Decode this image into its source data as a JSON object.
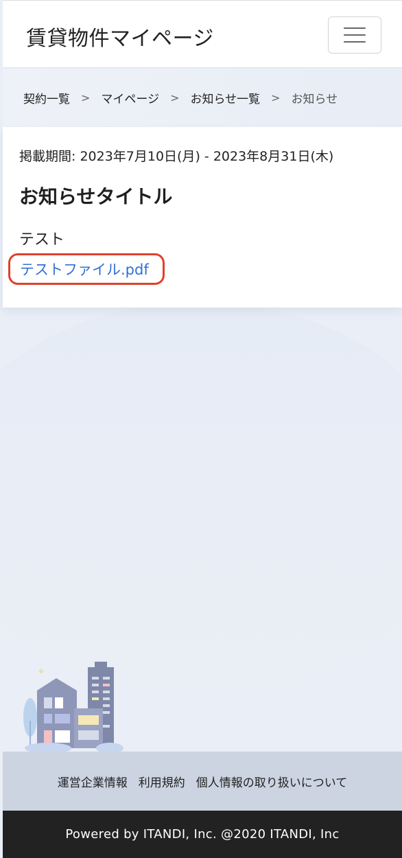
{
  "header": {
    "app_title": "賃貸物件マイページ",
    "menu_icon": "hamburger-menu-icon"
  },
  "breadcrumb": {
    "items": [
      "契約一覧",
      "マイページ",
      "お知らせ一覧",
      "お知らせ"
    ],
    "separator": ">"
  },
  "notice": {
    "period": "掲載期間: 2023年7月10日(月) - 2023年8月31日(木)",
    "title": "お知らせタイトル",
    "body": "テスト",
    "attachment": "テストファイル.pdf"
  },
  "footer": {
    "links": [
      "運営企業情報",
      "利用規約",
      "個人情報の取り扱いについて"
    ],
    "copyright": "Powered by ITANDI, Inc. @2020 ITANDI, Inc"
  },
  "colors": {
    "link": "#2f6fd6",
    "highlight_border": "#e0402a",
    "footer_bar": "#222222"
  }
}
